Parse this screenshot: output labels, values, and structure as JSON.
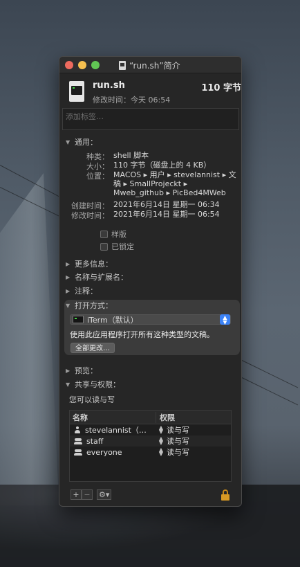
{
  "window": {
    "title": "“run.sh”简介"
  },
  "file": {
    "name": "run.sh",
    "size": "110 字节",
    "modified_line": "修改时间：今天 06:54"
  },
  "tags": {
    "placeholder": "添加标签…"
  },
  "general": {
    "header": "通用：",
    "kind_label": "种类：",
    "kind_value": "shell 脚本",
    "size_label": "大小：",
    "size_value": "110 字节（磁盘上的 4 KB）",
    "where_label": "位置：",
    "where_line1": "MACOS ▸ 用户 ▸ stevelannist ▸ 文",
    "where_line2": "稿 ▸ SmallProjeckt ▸",
    "where_line3": "Mweb_github ▸ PicBed4MWeb",
    "created_label": "创建时间：",
    "created_value": "2021年6月14日 星期一 06:34",
    "modified_label": "修改时间：",
    "modified_value": "2021年6月14日 星期一 06:54",
    "stationery_label": "样版",
    "locked_label": "已锁定"
  },
  "sections": {
    "more_info": "更多信息：",
    "name_ext": "名称与扩展名：",
    "comments": "注释：",
    "open_with": "打开方式：",
    "preview": "预览：",
    "sharing": "共享与权限："
  },
  "open_with": {
    "app_name": "iTerm（默认）",
    "description": "使用此应用程序打开所有这种类型的文稿。",
    "change_all_label": "全部更改…"
  },
  "sharing": {
    "access_text": "您可以读与写",
    "col_name": "名称",
    "col_privilege": "权限",
    "rows": [
      {
        "user": "stevelannist（…",
        "privilege": "读与写",
        "icon": "person-icon"
      },
      {
        "user": "staff",
        "privilege": "读与写",
        "icon": "group-icon"
      },
      {
        "user": "everyone",
        "privilege": "读与写",
        "icon": "group-icon"
      }
    ]
  },
  "bottom": {
    "add": "+",
    "remove": "−",
    "action": "⚙▾"
  },
  "colors": {
    "accent": "#3b82f6",
    "lock": "#d89a24"
  }
}
